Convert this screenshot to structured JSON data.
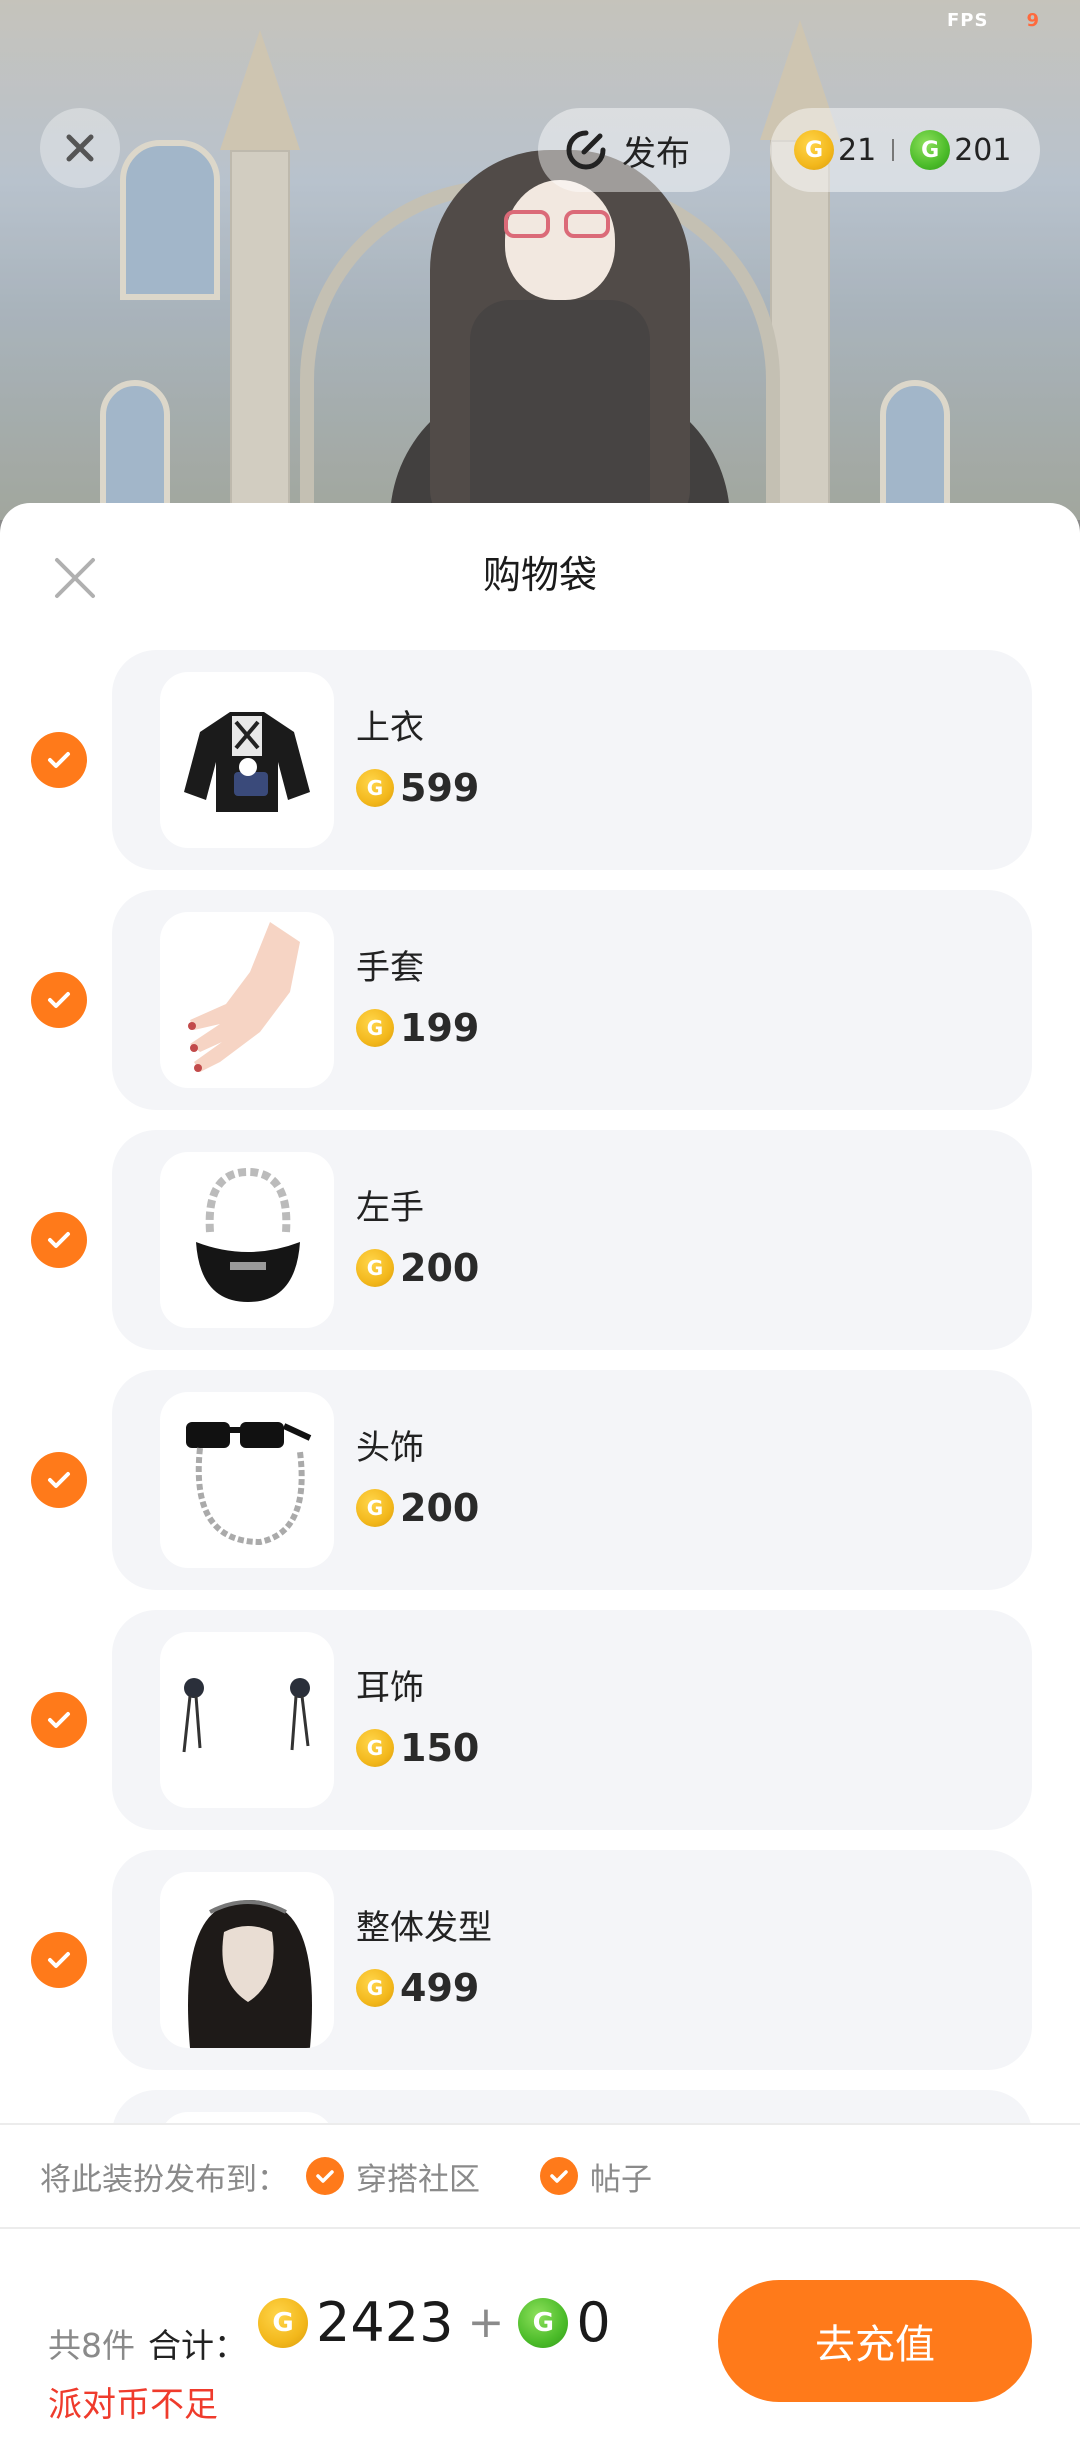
{
  "status": {
    "fps_label": "FPS",
    "fps_value": "9"
  },
  "topbar": {
    "publish_label": "发布",
    "gold_balance": "21",
    "green_balance": "201"
  },
  "sheet": {
    "title": "购物袋",
    "items": [
      {
        "name": "上衣",
        "price": "599",
        "checked": true,
        "thumb_icon": "jacket-icon"
      },
      {
        "name": "手套",
        "price": "199",
        "checked": true,
        "thumb_icon": "hand-icon"
      },
      {
        "name": "左手",
        "price": "200",
        "checked": true,
        "thumb_icon": "handbag-icon"
      },
      {
        "name": "头饰",
        "price": "200",
        "checked": true,
        "thumb_icon": "sunglasses-chain-icon"
      },
      {
        "name": "耳饰",
        "price": "150",
        "checked": true,
        "thumb_icon": "earrings-icon"
      },
      {
        "name": "整体发型",
        "price": "499",
        "checked": true,
        "thumb_icon": "hairstyle-icon"
      }
    ]
  },
  "publish_bar": {
    "lead": "将此装扮发布到：",
    "options": [
      {
        "label": "穿搭社区",
        "checked": true
      },
      {
        "label": "帖子",
        "checked": true
      }
    ]
  },
  "footer": {
    "count": "共8件",
    "total_label": "合计：",
    "gold_total": "2423",
    "plus": "+",
    "green_total": "0",
    "warning": "派对币不足",
    "recharge_label": "去充值"
  },
  "colors": {
    "accent": "#ff7a1a",
    "warning": "#ef3b2c",
    "gold": "#f3b81c",
    "green": "#4cbc2a"
  }
}
